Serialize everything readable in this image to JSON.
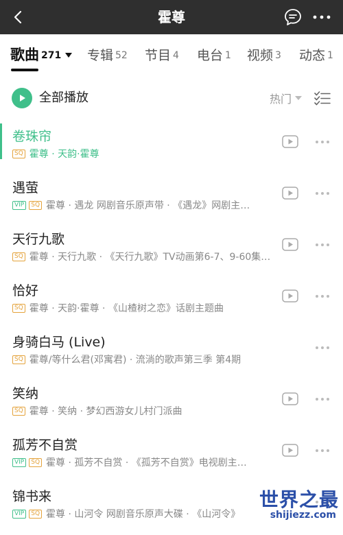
{
  "topbar": {
    "title": "霍尊",
    "back_icon": "back-arrow-icon",
    "comment_icon": "comment-bubble-icon",
    "more_icon": "more-dots-icon"
  },
  "tabs": [
    {
      "label": "歌曲",
      "count": "271",
      "active": true
    },
    {
      "label": "专辑",
      "count": "52",
      "active": false
    },
    {
      "label": "节目",
      "count": "4",
      "active": false
    },
    {
      "label": "电台",
      "count": "1",
      "active": false
    },
    {
      "label": "视频",
      "count": "3",
      "active": false
    },
    {
      "label": "动态",
      "count": "1",
      "active": false
    }
  ],
  "play_all": {
    "label": "全部播放",
    "sort_label": "热门",
    "play_icon": "play-circle-icon",
    "multiselect_icon": "multi-select-icon"
  },
  "songs": [
    {
      "title": "卷珠帘",
      "vip": false,
      "sq": true,
      "info": "霍尊 · 天韵·霍尊",
      "playing": true
    },
    {
      "title": "遇萤",
      "vip": true,
      "sq": true,
      "info": "霍尊 · 遇龙 网剧音乐原声带 · 《遇龙》网剧主…",
      "playing": false
    },
    {
      "title": "天行九歌",
      "vip": false,
      "sq": true,
      "info": "霍尊 · 天行九歌 · 《天行九歌》TV动画第6-7、9-60集…",
      "playing": false
    },
    {
      "title": "恰好",
      "vip": false,
      "sq": true,
      "info": "霍尊 · 天韵·霍尊 · 《山楂树之恋》话剧主题曲",
      "playing": false
    },
    {
      "title": "身骑白马 (Live)",
      "vip": false,
      "sq": true,
      "info": "霍尊/等什么君(邓寓君) · 流淌的歌声第三季 第4期",
      "playing": false
    },
    {
      "title": "笑纳",
      "vip": false,
      "sq": true,
      "info": "霍尊 · 笑纳 · 梦幻西游女儿村门派曲",
      "playing": false
    },
    {
      "title": "孤芳不自赏",
      "vip": true,
      "sq": true,
      "info": "霍尊 · 孤芳不自赏 · 《孤芳不自赏》电视剧主…",
      "playing": false
    },
    {
      "title": "锦书来",
      "vip": true,
      "sq": true,
      "info": "霍尊 · 山河令 网剧音乐原声大碟 · 《山河令》",
      "playing": false
    }
  ],
  "badges": {
    "vip": "VIP",
    "sq": "SQ"
  },
  "watermark": {
    "title": "世界之最",
    "url": "shijiezz.com"
  },
  "colors": {
    "accent": "#3fbf8a",
    "sq_badge": "#e4a23a",
    "topbar_bg": "#2f2f2f",
    "watermark": "#2b4fa8"
  }
}
